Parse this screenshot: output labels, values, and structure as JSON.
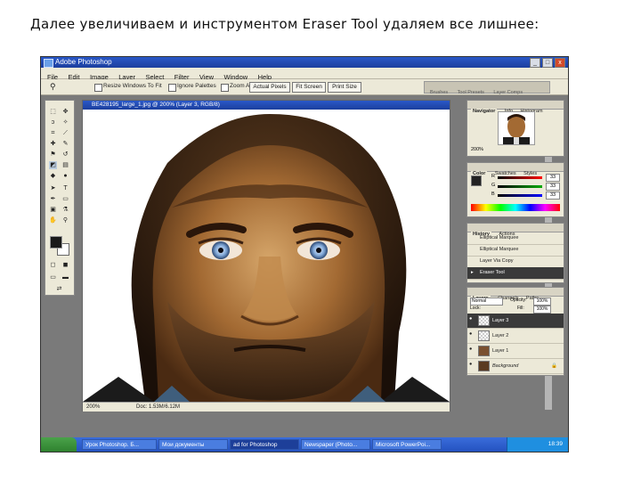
{
  "slide": {
    "caption": "Далее увеличиваем и инструментом Eraser Tool удаляем все лишнее:"
  },
  "window": {
    "title": "Adobe Photoshop",
    "minimize": "_",
    "maximize": "□",
    "close": "x"
  },
  "menu": [
    "File",
    "Edit",
    "Image",
    "Layer",
    "Select",
    "Filter",
    "View",
    "Window",
    "Help"
  ],
  "options": {
    "tool_icon": "zoom-icon",
    "resize_windows": "Resize Windows To Fit",
    "ignore_palettes": "Ignore Palettes",
    "zoom_all_windows": "Zoom All Windows",
    "actual_pixels": "Actual Pixels",
    "fit_screen": "Fit Screen",
    "print_size": "Print Size",
    "palette_well": [
      "Brushes",
      "Tool Presets",
      "Layer Comps"
    ]
  },
  "document": {
    "title": "BE428195_large_1.jpg @ 200% (Layer 3, RGB/8)",
    "zoom": "200%",
    "doc_size": "Doc: 1.53M/6.12M"
  },
  "navigator": {
    "tabs": [
      "Navigator",
      "Info",
      "Histogram"
    ],
    "zoom": "200%"
  },
  "color_panel": {
    "tabs": [
      "Color",
      "Swatches",
      "Styles"
    ],
    "channels": [
      {
        "label": "R",
        "value": "33"
      },
      {
        "label": "G",
        "value": "33"
      },
      {
        "label": "B",
        "value": "33"
      }
    ]
  },
  "history": {
    "tabs": [
      "History",
      "Actions"
    ],
    "items": [
      "Elliptical Marquee",
      "Elliptical Marquee",
      "Layer Via Copy",
      "Eraser Tool"
    ]
  },
  "layers": {
    "tabs": [
      "Layers",
      "Channels",
      "Paths"
    ],
    "blend_mode": "Normal",
    "opacity_label": "Opacity:",
    "opacity": "100%",
    "lock_label": "Lock:",
    "fill_label": "Fill:",
    "fill": "100%",
    "items": [
      {
        "name": "Layer 3",
        "selected": true
      },
      {
        "name": "Layer 2",
        "selected": false
      },
      {
        "name": "Layer 1",
        "selected": false
      },
      {
        "name": "Background",
        "selected": false
      }
    ]
  },
  "taskbar": {
    "start": "Start",
    "items": [
      "Урок Photoshop. Б...",
      "Мои документы",
      "ad for Photoshop",
      "Newspaper (Photo...",
      "Microsoft PowerPoi..."
    ],
    "clock": "18:39"
  },
  "colors": {
    "xp_blue": "#2452c0",
    "panel_bg": "#ece9d8",
    "selected_row": "#3a3a3a"
  }
}
